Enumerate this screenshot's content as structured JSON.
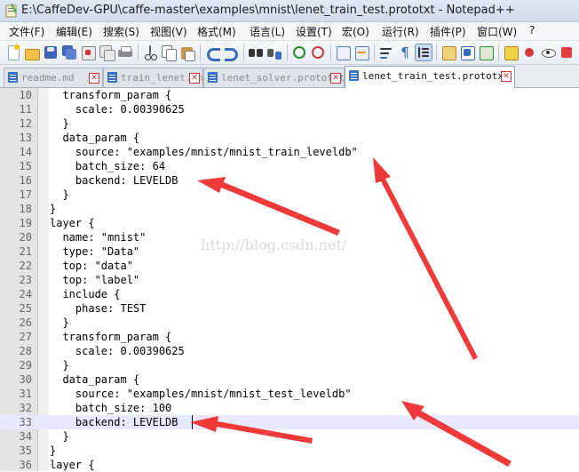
{
  "window": {
    "title": "E:\\CaffeDev-GPU\\caffe-master\\examples\\mnist\\lenet_train_test.prototxt - Notepad++"
  },
  "menu": {
    "items": [
      "文件(F)",
      "编辑(E)",
      "搜索(S)",
      "视图(V)",
      "格式(M)",
      "语言(L)",
      "设置(T)",
      "宏(O)",
      "运行(R)",
      "插件(P)",
      "窗口(W)",
      "?"
    ]
  },
  "toolbar": {
    "icons": [
      "new-file-icon",
      "open-file-icon",
      "save-icon",
      "save-all-icon",
      "close-icon",
      "close-all-icon",
      "print-icon",
      "cut-icon",
      "copy-icon",
      "paste-icon",
      "undo-icon",
      "redo-icon",
      "find-icon",
      "replace-icon",
      "zoom-in-icon",
      "zoom-out-icon",
      "sync-vertical-icon",
      "sync-horizontal-icon",
      "word-wrap-icon",
      "show-all-chars-icon",
      "indent-guide-icon",
      "user-define-icon",
      "doc-map-icon",
      "function-list-icon",
      "monitor-icon",
      "record-macro-icon",
      "view-icon"
    ]
  },
  "tabs": [
    {
      "label": "readme.md",
      "active": false
    },
    {
      "label": "train_lenet.sh",
      "active": false
    },
    {
      "label": "lenet_solver.prototxt",
      "active": false
    },
    {
      "label": "lenet_train_test.prototxt",
      "active": true
    }
  ],
  "editor": {
    "current_line": 33,
    "lines": [
      {
        "no": "10",
        "text": "  transform_param {"
      },
      {
        "no": "11",
        "text": "    scale: 0.00390625"
      },
      {
        "no": "12",
        "text": "  }"
      },
      {
        "no": "13",
        "text": "  data_param {"
      },
      {
        "no": "14",
        "text": "    source: \"examples/mnist/mnist_train_leveldb\""
      },
      {
        "no": "15",
        "text": "    batch_size: 64"
      },
      {
        "no": "16",
        "text": "    backend: LEVELDB"
      },
      {
        "no": "17",
        "text": "  }"
      },
      {
        "no": "18",
        "text": "}"
      },
      {
        "no": "19",
        "text": "layer {"
      },
      {
        "no": "20",
        "text": "  name: \"mnist\""
      },
      {
        "no": "21",
        "text": "  type: \"Data\""
      },
      {
        "no": "22",
        "text": "  top: \"data\""
      },
      {
        "no": "23",
        "text": "  top: \"label\""
      },
      {
        "no": "24",
        "text": "  include {"
      },
      {
        "no": "25",
        "text": "    phase: TEST"
      },
      {
        "no": "26",
        "text": "  }"
      },
      {
        "no": "27",
        "text": "  transform_param {"
      },
      {
        "no": "28",
        "text": "    scale: 0.00390625"
      },
      {
        "no": "29",
        "text": "  }"
      },
      {
        "no": "30",
        "text": "  data_param {"
      },
      {
        "no": "31",
        "text": "    source: \"examples/mnist/mnist_test_leveldb\""
      },
      {
        "no": "32",
        "text": "    batch_size: 100"
      },
      {
        "no": "33",
        "text": "    backend: LEVELDB"
      },
      {
        "no": "34",
        "text": "  }"
      },
      {
        "no": "35",
        "text": "}"
      },
      {
        "no": "36",
        "text": "layer {"
      }
    ]
  },
  "watermark": "http://blog.csdn.net/",
  "annotation_color": "#f03a3a"
}
